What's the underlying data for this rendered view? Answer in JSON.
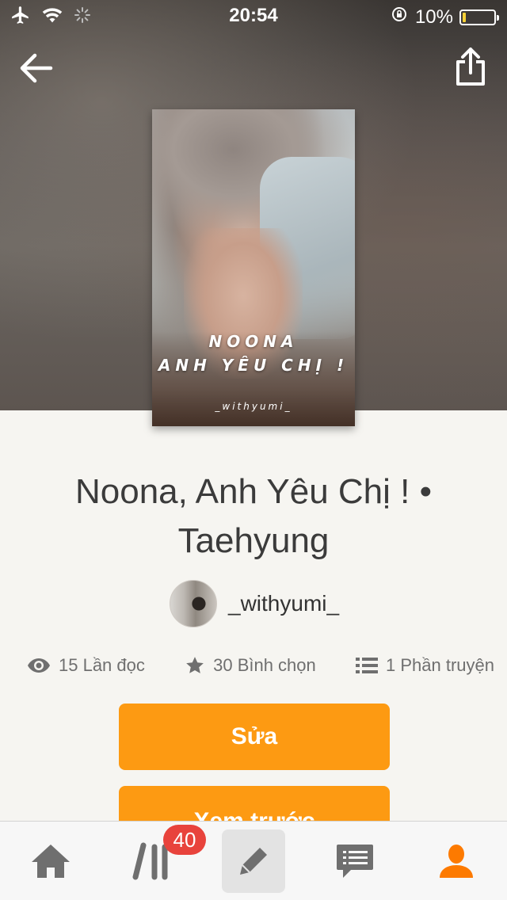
{
  "status_bar": {
    "time": "20:54",
    "battery": "10%",
    "battery_level": 0.1
  },
  "nav": {
    "back_icon": "arrow-left-icon",
    "share_icon": "share-icon"
  },
  "cover": {
    "title_line1": "NOONA",
    "title_line2": "ANH YÊU CHỊ !",
    "author_mark": "_withyumi_"
  },
  "story": {
    "title": "Noona, Anh Yêu Chị ! • Taehyung",
    "author": "_withyumi_"
  },
  "stats": {
    "reads": "15 Lần đọc",
    "votes": "30 Bình chọn",
    "parts": "1 Phần truyện"
  },
  "actions": {
    "edit_label": "Sửa",
    "preview_label": "Xem trước"
  },
  "tab_bar": {
    "library_badge": "40",
    "items": [
      "home-icon",
      "library-icon",
      "pencil-icon",
      "messages-icon",
      "profile-icon"
    ],
    "active_color": "#fd7a00",
    "inactive_color": "#6f6f6f"
  },
  "colors": {
    "accent": "#fd9a12",
    "badge": "#e8433c"
  }
}
